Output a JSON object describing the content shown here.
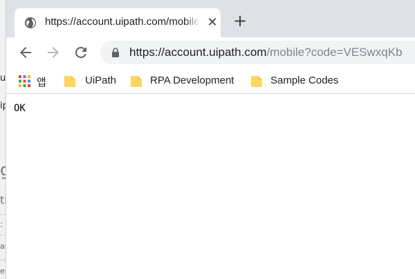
{
  "tab": {
    "title": "https://account.uipath.com/mobile?code=VESwxqKb",
    "close_label": "✕",
    "new_tab_label": "+"
  },
  "omnibox": {
    "url_host": "https://account.uipath.com",
    "url_path": "/mobile?code=VESwxqKb"
  },
  "bookmarks": [
    {
      "label": "앱"
    },
    {
      "label": "UiPath"
    },
    {
      "label": "RPA Development"
    },
    {
      "label": "Sample Codes"
    }
  ],
  "page": {
    "body_text": "OK"
  },
  "behind_window": {
    "t1": "ur",
    "t2": "ip",
    "t3": "g",
    "t4": "th",
    "t5": ":",
    "t6": "as",
    "t7": "en"
  },
  "colors": {
    "tabstrip": "#dee1e6",
    "omnibox": "#f1f3f4",
    "folder": "#fdd663"
  }
}
